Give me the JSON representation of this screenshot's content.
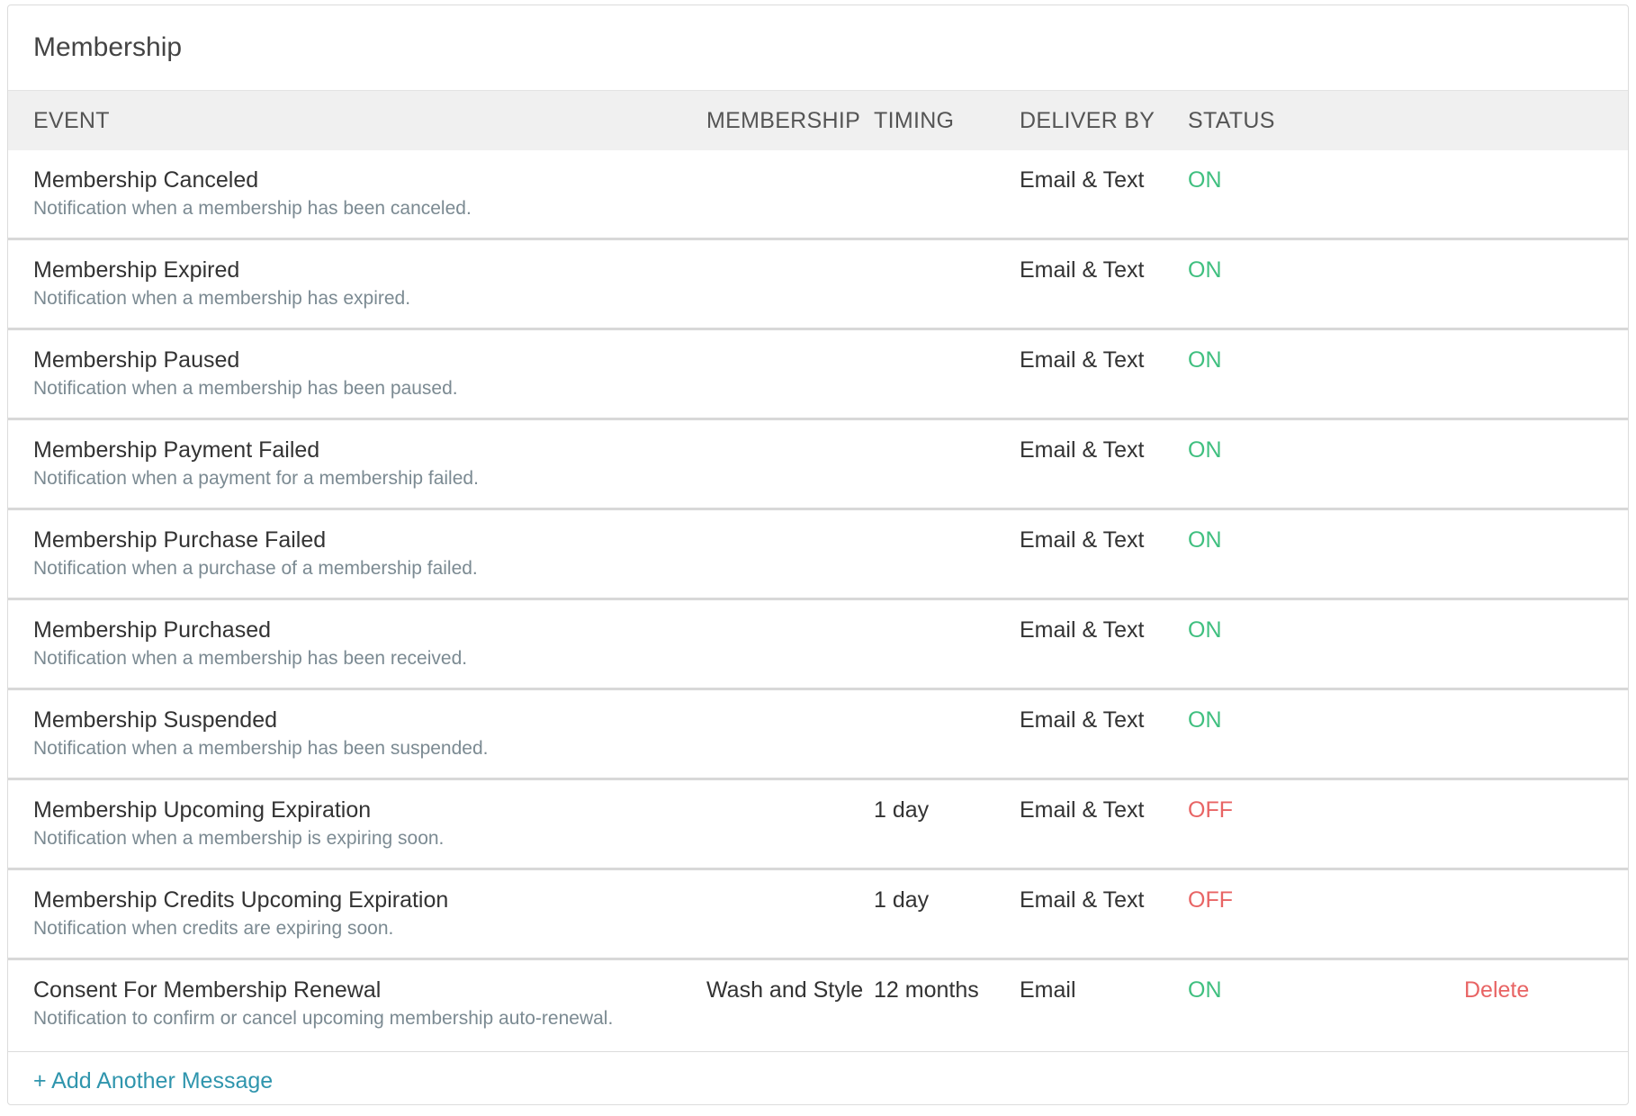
{
  "panel": {
    "title": "Membership"
  },
  "columns": {
    "event": "EVENT",
    "membership": "MEMBERSHIP",
    "timing": "TIMING",
    "deliver_by": "DELIVER BY",
    "status": "STATUS"
  },
  "rows": [
    {
      "title": "Membership Canceled",
      "desc": "Notification when a membership has been canceled.",
      "membership": "",
      "timing": "",
      "deliver": "Email & Text",
      "status": "ON"
    },
    {
      "title": "Membership Expired",
      "desc": "Notification when a membership has expired.",
      "membership": "",
      "timing": "",
      "deliver": "Email & Text",
      "status": "ON"
    },
    {
      "title": "Membership Paused",
      "desc": "Notification when a membership has been paused.",
      "membership": "",
      "timing": "",
      "deliver": "Email & Text",
      "status": "ON"
    },
    {
      "title": "Membership Payment Failed",
      "desc": "Notification when a payment for a membership failed.",
      "membership": "",
      "timing": "",
      "deliver": "Email & Text",
      "status": "ON"
    },
    {
      "title": "Membership Purchase Failed",
      "desc": "Notification when a purchase of a membership failed.",
      "membership": "",
      "timing": "",
      "deliver": "Email & Text",
      "status": "ON"
    },
    {
      "title": "Membership Purchased",
      "desc": "Notification when a membership has been received.",
      "membership": "",
      "timing": "",
      "deliver": "Email & Text",
      "status": "ON"
    },
    {
      "title": "Membership Suspended",
      "desc": "Notification when a membership has been suspended.",
      "membership": "",
      "timing": "",
      "deliver": "Email & Text",
      "status": "ON"
    },
    {
      "title": "Membership Upcoming Expiration",
      "desc": "Notification when a membership is expiring soon.",
      "membership": "",
      "timing": "1 day",
      "deliver": "Email & Text",
      "status": "OFF"
    },
    {
      "title": "Membership Credits Upcoming Expiration",
      "desc": "Notification when credits are expiring soon.",
      "membership": "",
      "timing": "1 day",
      "deliver": "Email & Text",
      "status": "OFF"
    },
    {
      "title": "Consent For Membership Renewal",
      "desc": "Notification to confirm or cancel upcoming membership auto-renewal.",
      "membership": "Wash and Style",
      "timing": "12 months",
      "deliver": "Email",
      "status": "ON",
      "action": "Delete"
    }
  ],
  "footer": {
    "add_label": "+ Add Another Message"
  },
  "colors": {
    "on": "#3fbf7f",
    "off": "#e86464",
    "link": "#2f95ad"
  }
}
